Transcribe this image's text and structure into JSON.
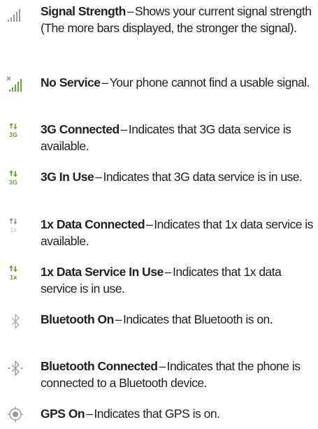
{
  "entries": [
    {
      "term": "Signal Strength",
      "sep": "–",
      "desc": "Shows your current signal strength (The more bars displayed, the stronger the signal).",
      "icon": "signal-strength-icon"
    },
    {
      "term": "No Service",
      "sep": "–",
      "desc": "Your phone cannot find a usable signal.",
      "icon": "no-service-icon"
    },
    {
      "term": "3G Connected",
      "sep": "–",
      "desc": "Indicates that 3G data service is available.",
      "icon": "3g-connected-icon",
      "icon_text": "3G"
    },
    {
      "term": "3G In Use",
      "sep": "–",
      "desc": "Indicates that 3G data service is in use.",
      "icon": "3g-in-use-icon",
      "icon_text": "3G"
    },
    {
      "term": "1x Data Connected",
      "sep": "–",
      "desc": "Indicates that 1x data service is available.",
      "icon": "1x-data-connected-icon",
      "icon_text": "1x"
    },
    {
      "term": "1x Data Service In Use",
      "sep": "–",
      "desc": "Indicates that 1x data service is in use.",
      "icon": "1x-data-in-use-icon",
      "icon_text": "1x"
    },
    {
      "term": "Bluetooth On",
      "sep": "–",
      "desc": "Indicates that Bluetooth is on.",
      "icon": "bluetooth-on-icon"
    },
    {
      "term": "Bluetooth Connected",
      "sep": "–",
      "desc": "Indicates that the phone is connected to a Bluetooth device.",
      "icon": "bluetooth-connected-icon"
    },
    {
      "term": "GPS On",
      "sep": "–",
      "desc": "Indicates that GPS is on.",
      "icon": "gps-on-icon"
    }
  ],
  "colors": {
    "text": "#231f20",
    "icon_gray": "#9a9a9a",
    "icon_green": "#66a832",
    "icon_green_light": "#a9d27d",
    "icon_red": "#c0392b"
  }
}
